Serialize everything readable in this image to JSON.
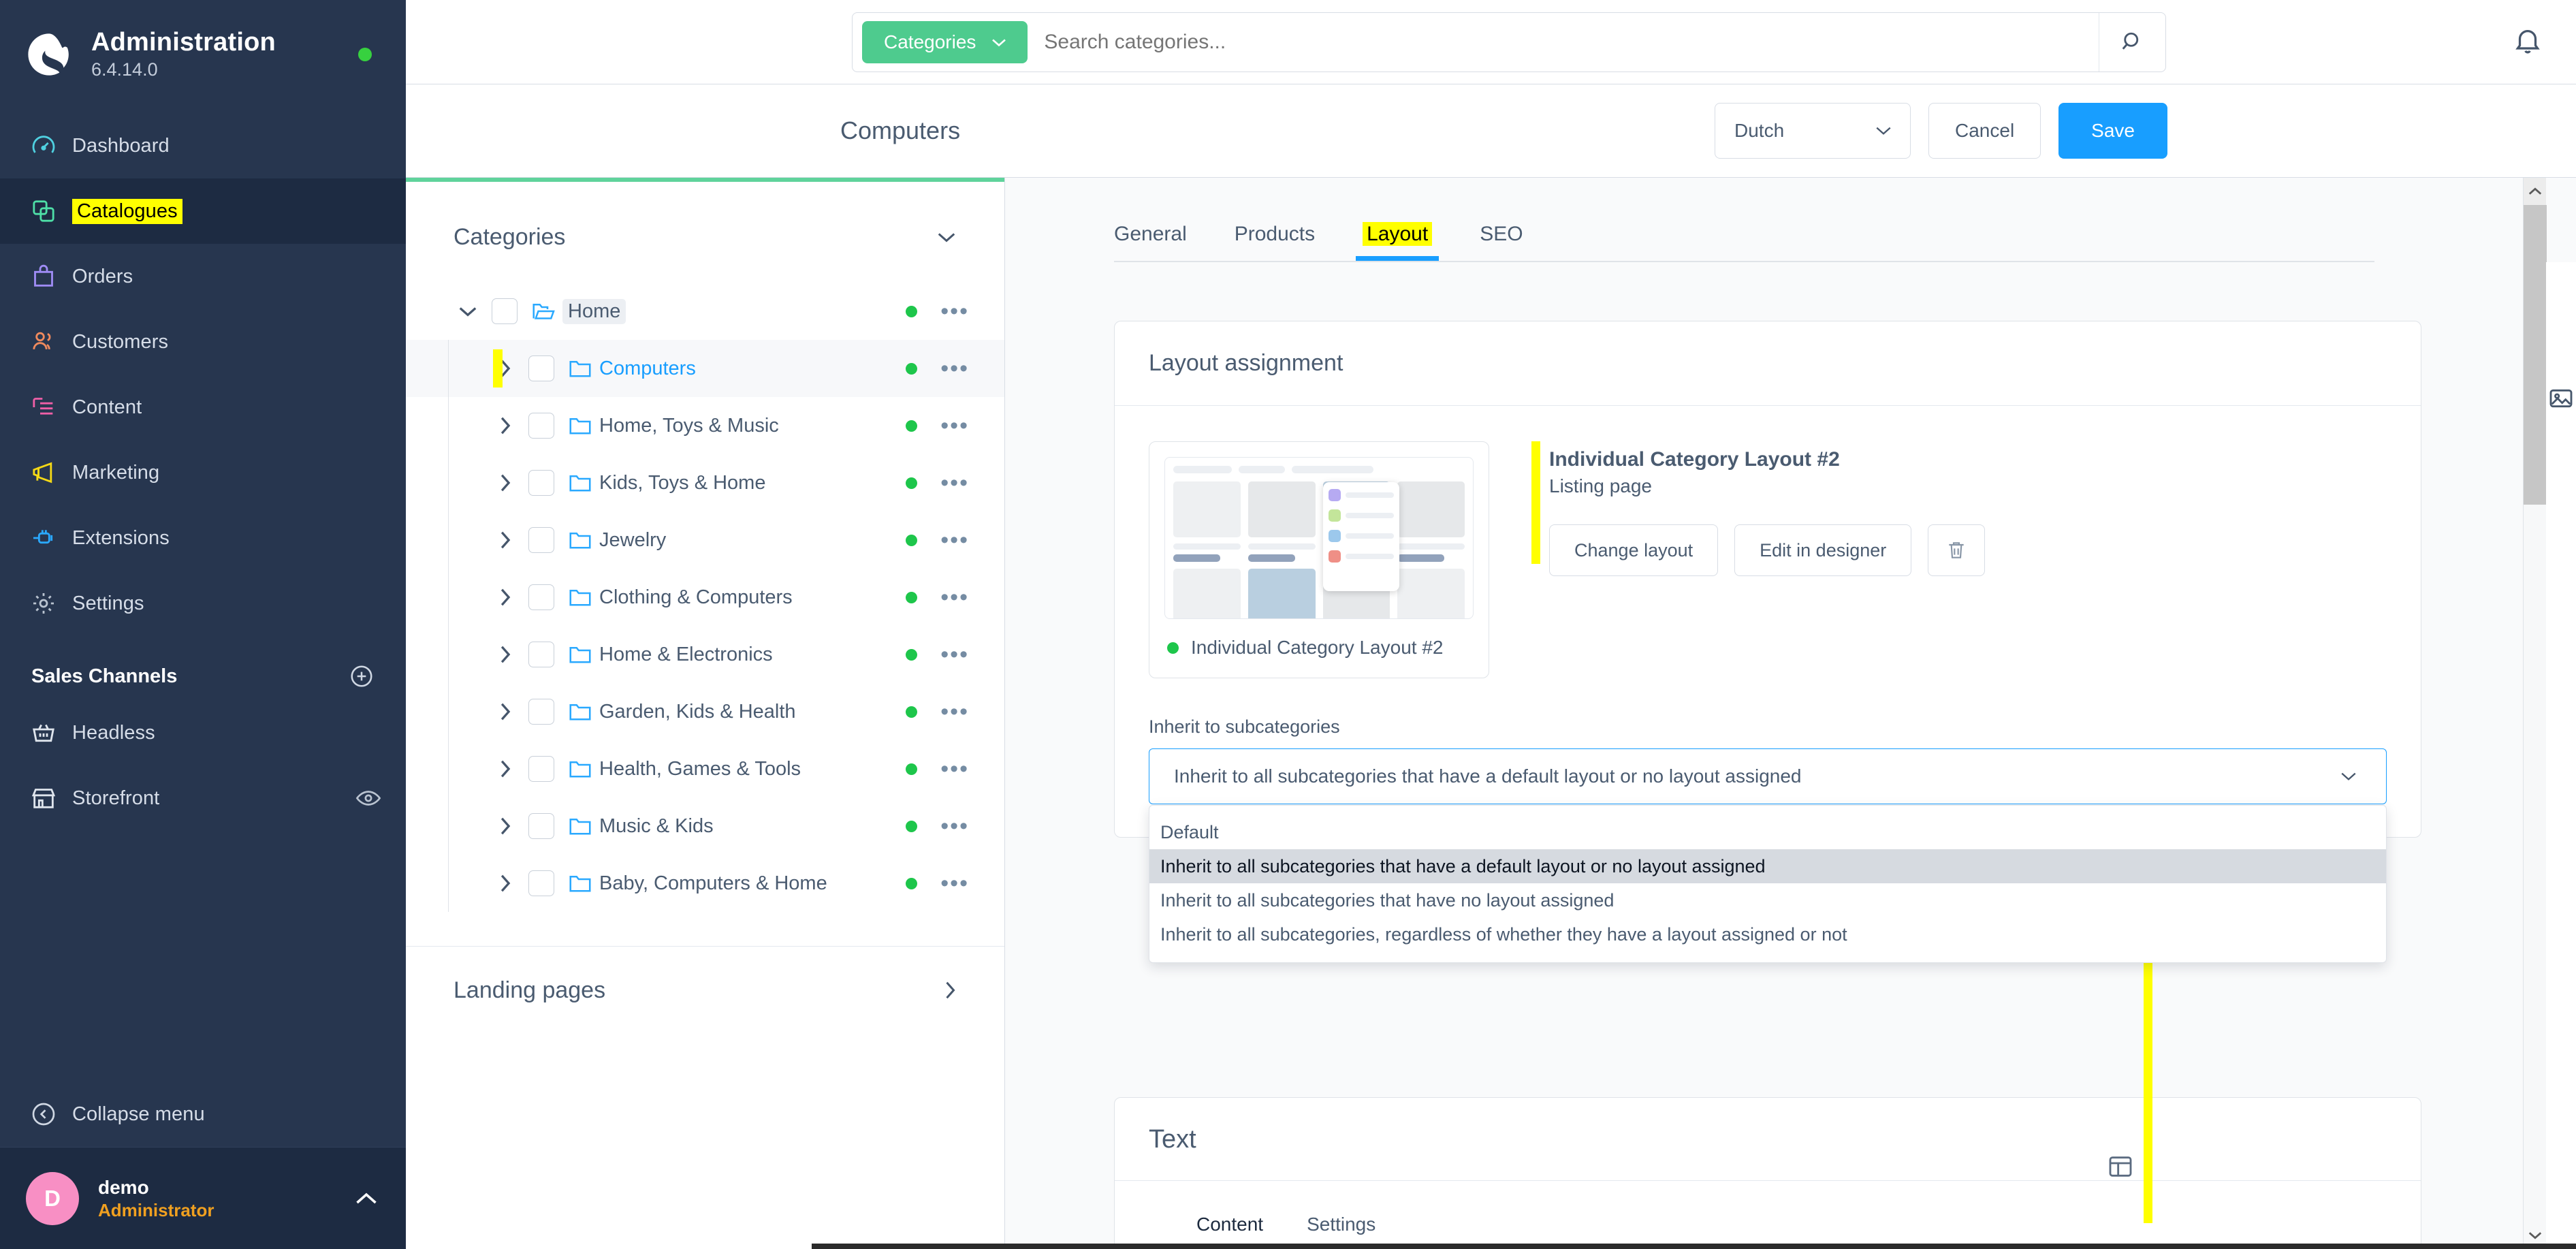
{
  "sidebar": {
    "app_title": "Administration",
    "version": "6.4.14.0",
    "status_color": "#37d13f",
    "nav": [
      {
        "label": "Dashboard",
        "icon": "gauge-icon",
        "active": false,
        "highlighted": false
      },
      {
        "label": "Catalogues",
        "icon": "catalogue-icon",
        "active": true,
        "highlighted": true
      },
      {
        "label": "Orders",
        "icon": "bag-icon",
        "active": false,
        "highlighted": false
      },
      {
        "label": "Customers",
        "icon": "users-icon",
        "active": false,
        "highlighted": false
      },
      {
        "label": "Content",
        "icon": "content-icon",
        "active": false,
        "highlighted": false
      },
      {
        "label": "Marketing",
        "icon": "megaphone-icon",
        "active": false,
        "highlighted": false
      },
      {
        "label": "Extensions",
        "icon": "plug-icon",
        "active": false,
        "highlighted": false
      },
      {
        "label": "Settings",
        "icon": "gear-icon",
        "active": false,
        "highlighted": false
      }
    ],
    "sales_channels_title": "Sales Channels",
    "sales_channels": [
      {
        "label": "Headless",
        "icon": "basket-icon",
        "has_eye": false
      },
      {
        "label": "Storefront",
        "icon": "shop-icon",
        "has_eye": true
      }
    ],
    "collapse_label": "Collapse menu",
    "user": {
      "initial": "D",
      "name": "demo",
      "role": "Administrator"
    }
  },
  "topbar": {
    "search_scope": "Categories",
    "search_placeholder": "Search categories...",
    "search_value": "",
    "notifications_icon": "bell-icon"
  },
  "pagehead": {
    "title": "Computers",
    "language": "Dutch",
    "cancel_label": "Cancel",
    "save_label": "Save"
  },
  "categories_panel": {
    "title": "Categories",
    "tree": [
      {
        "label": "Home",
        "depth": 0,
        "expanded": true,
        "chip": true,
        "link": false,
        "selected": false,
        "marked": false,
        "active_dot": true
      },
      {
        "label": "Computers",
        "depth": 1,
        "expanded": false,
        "chip": false,
        "link": true,
        "selected": true,
        "marked": true,
        "active_dot": true
      },
      {
        "label": "Home, Toys & Music",
        "depth": 1,
        "expanded": false,
        "chip": false,
        "link": false,
        "selected": false,
        "marked": false,
        "active_dot": true
      },
      {
        "label": "Kids, Toys & Home",
        "depth": 1,
        "expanded": false,
        "chip": false,
        "link": false,
        "selected": false,
        "marked": false,
        "active_dot": true
      },
      {
        "label": "Jewelry",
        "depth": 1,
        "expanded": false,
        "chip": false,
        "link": false,
        "selected": false,
        "marked": false,
        "active_dot": true
      },
      {
        "label": "Clothing & Computers",
        "depth": 1,
        "expanded": false,
        "chip": false,
        "link": false,
        "selected": false,
        "marked": false,
        "active_dot": true
      },
      {
        "label": "Home & Electronics",
        "depth": 1,
        "expanded": false,
        "chip": false,
        "link": false,
        "selected": false,
        "marked": false,
        "active_dot": true
      },
      {
        "label": "Garden, Kids & Health",
        "depth": 1,
        "expanded": false,
        "chip": false,
        "link": false,
        "selected": false,
        "marked": false,
        "active_dot": true
      },
      {
        "label": "Health, Games & Tools",
        "depth": 1,
        "expanded": false,
        "chip": false,
        "link": false,
        "selected": false,
        "marked": false,
        "active_dot": true
      },
      {
        "label": "Music & Kids",
        "depth": 1,
        "expanded": false,
        "chip": false,
        "link": false,
        "selected": false,
        "marked": false,
        "active_dot": true
      },
      {
        "label": "Baby, Computers & Home",
        "depth": 1,
        "expanded": false,
        "chip": false,
        "link": false,
        "selected": false,
        "marked": false,
        "active_dot": true
      }
    ],
    "landing_pages_label": "Landing pages"
  },
  "main": {
    "tabs": [
      {
        "label": "General",
        "active": false,
        "highlighted": false
      },
      {
        "label": "Products",
        "active": false,
        "highlighted": false
      },
      {
        "label": "Layout",
        "active": true,
        "highlighted": true
      },
      {
        "label": "SEO",
        "active": false,
        "highlighted": false
      }
    ],
    "layout_card": {
      "title": "Layout assignment",
      "preview_name": "Individual Category Layout #2",
      "meta_title": "Individual Category Layout #2",
      "meta_subtitle": "Listing page",
      "change_layout_label": "Change layout",
      "edit_designer_label": "Edit in designer",
      "delete_icon": "trash-icon",
      "inherit_field_label": "Inherit to subcategories",
      "inherit_selected": "Inherit to all subcategories that have a default layout or no layout assigned",
      "inherit_options": [
        {
          "label": "Default",
          "selected": false
        },
        {
          "label": "Inherit to all subcategories that have a default layout or no layout assigned",
          "selected": true
        },
        {
          "label": "Inherit to all subcategories that have no layout assigned",
          "selected": false
        },
        {
          "label": "Inherit to all subcategories, regardless of whether they have a layout assigned or not",
          "selected": false
        }
      ]
    },
    "text_card": {
      "title": "Text",
      "tabs": [
        {
          "label": "Content",
          "active": true
        },
        {
          "label": "Settings",
          "active": false
        }
      ]
    }
  },
  "colors": {
    "sidebar_bg": "#27364f",
    "accent_blue": "#189eff",
    "accent_green": "#4ecb8e",
    "highlight_yellow": "#ffff00",
    "status_green": "#1ec64b"
  }
}
